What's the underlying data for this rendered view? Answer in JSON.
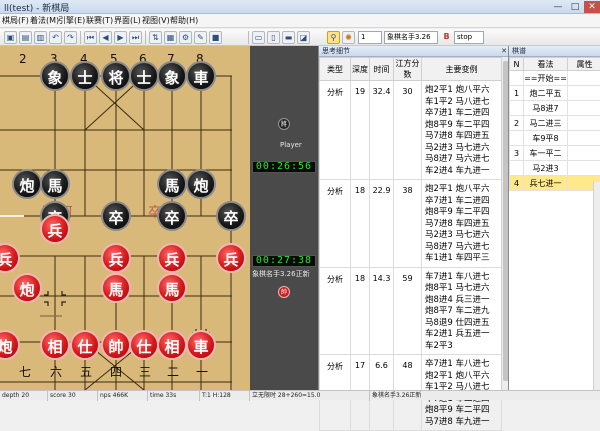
{
  "window": {
    "title": "ll(test) - 新棋局",
    "minimize": "—",
    "maximize": "□",
    "close": "✕"
  },
  "menu": [
    "棋局(F)",
    "着法(M)",
    "引擎(E)",
    "联赛(T)",
    "界面(L)",
    "视图(V)",
    "帮助(H)"
  ],
  "toolbar": {
    "buttons": [
      "save-icon",
      "open-icon",
      "print-icon",
      "undo-icon",
      "redo-icon",
      "first-icon",
      "prev-icon",
      "next-icon",
      "last-icon",
      "flip-icon",
      "board-icon",
      "engine-icon",
      "analyze-icon",
      "stop-icon",
      "hint-icon",
      "book-icon",
      "settings-icon"
    ],
    "level_value": "1",
    "engine_value": "象棋名手3.26",
    "stop_label": "stop"
  },
  "board": {
    "top_labels": [
      "2",
      "3",
      "4",
      "5",
      "6",
      "7",
      "8"
    ],
    "bottom_labels": [
      "七",
      "六",
      "五",
      "四",
      "三",
      "二",
      "一"
    ],
    "river_left": "兵 河",
    "river_right": "卒 界",
    "pieces": {
      "black": [
        "象",
        "士",
        "将",
        "士",
        "象",
        "車",
        "炮",
        "馬",
        "馬",
        "炮",
        "卒",
        "卒",
        "卒",
        "卒"
      ],
      "red": [
        "兵",
        "兵",
        "兵",
        "兵",
        "兵",
        "炮",
        "馬",
        "馬",
        "炮",
        "相",
        "仕",
        "帥",
        "仕",
        "相",
        "車",
        "傌"
      ]
    }
  },
  "side_panel": {
    "top_piece": "將",
    "player_label": "Player",
    "clock_top": "00:26:56",
    "clock_bottom": "00:27:38",
    "engine_label": "象棋名手3.26正新",
    "bottom_piece": "帥"
  },
  "analysis": {
    "title": "思考细节",
    "close": "✕",
    "columns": [
      "类型",
      "深度",
      "时间",
      "江方分数",
      "主要变例"
    ],
    "rows": [
      {
        "type": "分析",
        "depth": "19",
        "time": "32.4",
        "score": "30",
        "pv": "炮2平1 炮八平六 车1平2 马八进七 卒7进1 车二进四 炮8平9 车二平四 马7进8 车四进五 马2进3 马七进六 马8进7 马六进七 车2进4 车九进一"
      },
      {
        "type": "分析",
        "depth": "18",
        "time": "22.9",
        "score": "38",
        "pv": "炮2平1 炮八平六 卒7进1 车二进四 炮8平9 车二平四 马7进8 车四进五 马2进3 马七进六 马8进7 马六进七 车1进1 车四平三"
      },
      {
        "type": "分析",
        "depth": "18",
        "time": "14.3",
        "score": "59",
        "pv": "车7进1 车八进七 炮8平1 马七进六 炮8进4 兵三进一 炮8平7 车二进九 马8退9 仕四进五 车2进1 兵五进一 车2平3"
      },
      {
        "type": "分析",
        "depth": "17",
        "time": "6.6",
        "score": "48",
        "pv": "卒7进1 车八进七 炮2平1 炮八平六 车1平2 马八进七 卒7进1 车二进四 炮8平9 车二平四 马7进8 车九进一"
      }
    ]
  },
  "moves": {
    "title": "棋谱",
    "columns": [
      "N",
      "看法",
      "属性"
    ],
    "rows": [
      {
        "n": "",
        "move": "==开始==",
        "attr": ""
      },
      {
        "n": "1",
        "move": "炮二平五",
        "attr": ""
      },
      {
        "n": "",
        "move": "马8进7",
        "attr": ""
      },
      {
        "n": "2",
        "move": "马二进三",
        "attr": ""
      },
      {
        "n": "",
        "move": "车9平8",
        "attr": ""
      },
      {
        "n": "3",
        "move": "车一平二",
        "attr": ""
      },
      {
        "n": "",
        "move": "马2进3",
        "attr": ""
      },
      {
        "n": "4",
        "move": "兵七进一",
        "attr": ""
      }
    ],
    "selected_index": 7
  },
  "status": {
    "depth": "depth 20",
    "score": "score 30",
    "nps": "nps 466K",
    "time": "time 33s",
    "hash": "T:1 H:128",
    "book": "立无限时 28+260=15.0",
    "engine": "象棋名手3.26正新"
  },
  "colors": {
    "board": "#d9b97a",
    "red_piece": "#d41a1a",
    "black_piece": "#1a1a1a",
    "clock_digits": "#27e62b",
    "selected_move": "#ffe98a"
  }
}
